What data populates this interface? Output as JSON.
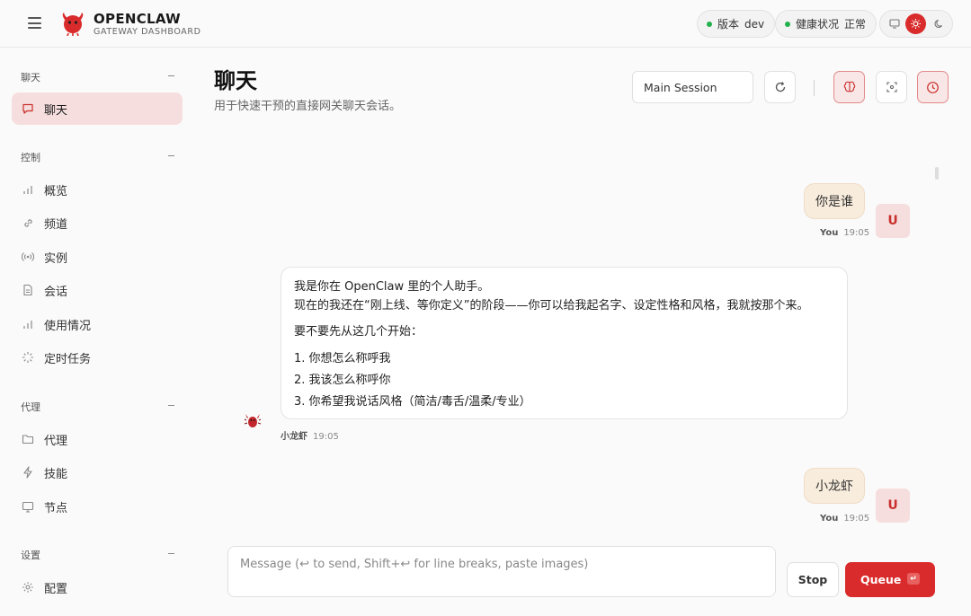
{
  "brand": {
    "title": "OPENCLAW",
    "subtitle": "GATEWAY DASHBOARD"
  },
  "status": {
    "version_label": "版本",
    "version_value": "dev",
    "health_label": "健康状况",
    "health_value": "正常",
    "status_color": "#22b14c"
  },
  "theme": {
    "active": "sun-icon",
    "accent": "#d92b2b"
  },
  "sidebar": {
    "sections": [
      {
        "title": "聊天",
        "items": [
          {
            "label": "聊天",
            "icon": "chat-bubble-icon",
            "active": true
          }
        ]
      },
      {
        "title": "控制",
        "items": [
          {
            "label": "概览",
            "icon": "bar-chart-icon"
          },
          {
            "label": "频道",
            "icon": "link-icon"
          },
          {
            "label": "实例",
            "icon": "broadcast-icon"
          },
          {
            "label": "会话",
            "icon": "document-icon"
          },
          {
            "label": "使用情况",
            "icon": "bar-chart-icon"
          },
          {
            "label": "定时任务",
            "icon": "loader-icon"
          }
        ]
      },
      {
        "title": "代理",
        "items": [
          {
            "label": "代理",
            "icon": "folder-icon"
          },
          {
            "label": "技能",
            "icon": "lightning-icon"
          },
          {
            "label": "节点",
            "icon": "monitor-icon"
          }
        ]
      },
      {
        "title": "设置",
        "items": [
          {
            "label": "配置",
            "icon": "gear-icon"
          }
        ]
      }
    ]
  },
  "page": {
    "title": "聊天",
    "subtitle": "用于快速干预的直接网关聊天会话。"
  },
  "session": {
    "selected": "Main Session"
  },
  "messages": [
    {
      "role": "user",
      "avatar": "U",
      "text": "你是谁",
      "sender": "You",
      "time": "19:05"
    },
    {
      "role": "assistant",
      "sender": "小龙虾",
      "time": "19:05",
      "line1": "我是你在 OpenClaw 里的个人助手。",
      "line2": "现在的我还在“刚上线、等你定义”的阶段——你可以给我起名字、设定性格和风格，我就按那个来。",
      "line3": "要不要先从这几个开始：",
      "list": [
        "1. 你想怎么称呼我",
        "2. 我该怎么称呼你",
        "3. 你希望我说话风格（简洁/毒舌/温柔/专业）"
      ]
    },
    {
      "role": "user",
      "avatar": "U",
      "text": "小龙虾",
      "sender": "You",
      "time": "19:05"
    }
  ],
  "composer": {
    "placeholder": "Message (↩ to send, Shift+↩ for line breaks, paste images)",
    "stop_label": "Stop",
    "queue_label": "Queue",
    "queue_hint": "↵"
  }
}
